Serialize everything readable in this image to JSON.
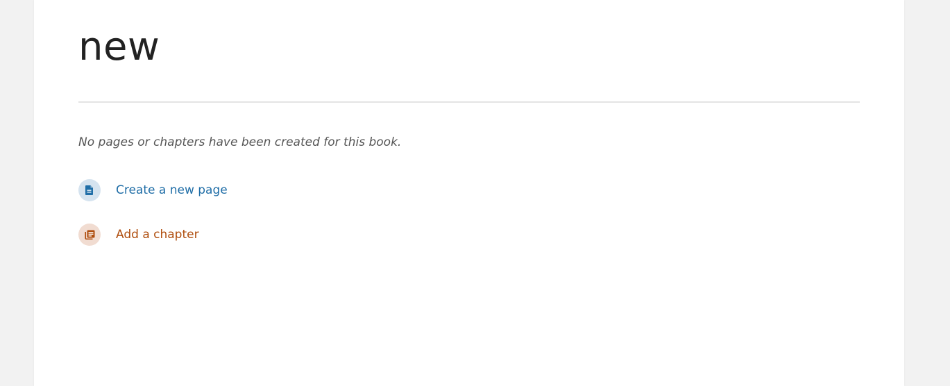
{
  "book": {
    "title": "new",
    "empty_message": "No pages or chapters have been created for this book."
  },
  "actions": {
    "create_page": {
      "label": "Create a new page",
      "icon": "page-icon",
      "color": "#206ea7"
    },
    "add_chapter": {
      "label": "Add a chapter",
      "icon": "chapter-icon",
      "color": "#af4d0d"
    }
  },
  "colors": {
    "background": "#f2f2f2",
    "card": "#ffffff",
    "title_text": "#222222"
  }
}
